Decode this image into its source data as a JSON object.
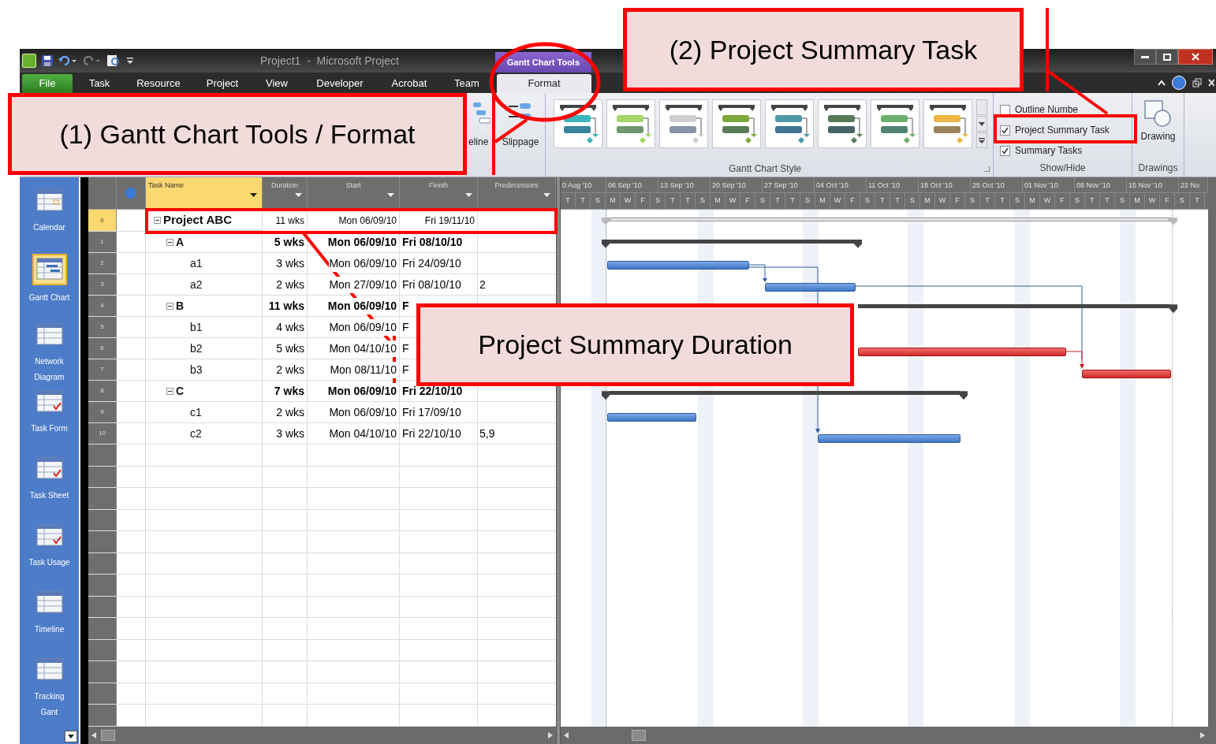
{
  "window": {
    "title": "Project1  -  Microsoft Project"
  },
  "context_tab_group": {
    "label": "Gantt Chart Tools"
  },
  "ribbon_tabs": [
    {
      "label": "File",
      "kind": "backstage",
      "selected": false
    },
    {
      "label": "Task",
      "kind": "tab",
      "selected": false
    },
    {
      "label": "Resource",
      "kind": "tab",
      "selected": false
    },
    {
      "label": "Project",
      "kind": "tab",
      "selected": false
    },
    {
      "label": "View",
      "kind": "tab",
      "selected": false
    },
    {
      "label": "Developer",
      "kind": "tab",
      "selected": false
    },
    {
      "label": "Acrobat",
      "kind": "tab",
      "selected": false
    },
    {
      "label": "Team",
      "kind": "tab",
      "selected": false
    },
    {
      "label": "Format",
      "kind": "contextual",
      "selected": true
    }
  ],
  "ribbon": {
    "partial_button": {
      "label": "eline"
    },
    "slippage": {
      "label": "Slippage"
    },
    "gantt_chart_style": {
      "label": "Gantt Chart Style",
      "styles": [
        {
          "color": "#3cb4bc"
        },
        {
          "color": "#a4d66a"
        },
        {
          "color": "#cfcfcf"
        },
        {
          "color": "#7fa83c"
        },
        {
          "color": "#4f98a6"
        },
        {
          "color": "#567a58"
        },
        {
          "color": "#6cb06c"
        },
        {
          "color": "#f0b442"
        }
      ]
    },
    "show_hide": {
      "label": "Show/Hide",
      "items": [
        {
          "label": "Outline Numbe",
          "checked": false
        },
        {
          "label": "Project Summary Task",
          "checked": true
        },
        {
          "label": "Summary Tasks",
          "checked": true
        }
      ]
    },
    "drawings": {
      "label": "Drawings",
      "button": "Drawing"
    }
  },
  "views": [
    {
      "label": "Calendar",
      "selected": false
    },
    {
      "label": "Gantt Chart",
      "selected": true
    },
    {
      "label": "Network Diagram",
      "selected": false
    },
    {
      "label": "Task Form",
      "selected": false
    },
    {
      "label": "Task Sheet",
      "selected": false
    },
    {
      "label": "Task Usage",
      "selected": false
    },
    {
      "label": "Timeline",
      "selected": false
    },
    {
      "label": "Tracking Gant",
      "selected": false
    }
  ],
  "table": {
    "columns": [
      {
        "label": "Task Name",
        "selected": true
      },
      {
        "label": "Duration",
        "selected": false
      },
      {
        "label": "Start",
        "selected": false
      },
      {
        "label": "Finish",
        "selected": false
      },
      {
        "label": "Predecessors",
        "selected": false
      }
    ],
    "rows": [
      {
        "id": "0",
        "name": "Project ABC",
        "kind": "project",
        "expanded": true,
        "selected": true,
        "duration": "11 wks",
        "start": "Mon 06/09/10",
        "finish": "Fri 19/11/10",
        "children": [
          {
            "id": "1",
            "name": "A",
            "kind": "summary",
            "expanded": true,
            "selected": false,
            "duration": "5 wks",
            "start": "Mon 06/09/10",
            "finish": "Fri 08/10/10",
            "children": [
              {
                "id": "2",
                "name": "a1",
                "kind": "task",
                "critical": false,
                "selected": false,
                "duration": "3 wks",
                "start": "Mon 06/09/10",
                "finish": "Fri 24/09/10"
              },
              {
                "id": "3",
                "name": "a2",
                "kind": "task",
                "critical": false,
                "selected": false,
                "duration": "2 wks",
                "start": "Mon 27/09/10",
                "finish": "Fri 08/10/10",
                "predecessors": "2"
              }
            ]
          },
          {
            "id": "4",
            "name": "B",
            "kind": "summary",
            "expanded": true,
            "selected": false,
            "duration": "11 wks",
            "start": "Mon 06/09/10",
            "finish": "F",
            "children": [
              {
                "id": "5",
                "name": "b1",
                "kind": "task",
                "selected": false,
                "duration": "4 wks",
                "start": "Mon 06/09/10",
                "finish": "F"
              },
              {
                "id": "6",
                "name": "b2",
                "kind": "task",
                "critical": true,
                "selected": false,
                "duration": "5 wks",
                "start": "Mon 04/10/10",
                "finish": "F"
              },
              {
                "id": "7",
                "name": "b3",
                "kind": "task",
                "critical": true,
                "selected": false,
                "duration": "2 wks",
                "start": "Mon 08/11/10",
                "finish": "F"
              }
            ]
          },
          {
            "id": "8",
            "name": "C",
            "kind": "summary",
            "expanded": true,
            "selected": false,
            "duration": "7 wks",
            "start": "Mon 06/09/10",
            "finish": "Fri 22/10/10",
            "children": [
              {
                "id": "9",
                "name": "c1",
                "kind": "task",
                "critical": false,
                "selected": false,
                "duration": "2 wks",
                "start": "Mon 06/09/10",
                "finish": "Fri 17/09/10"
              },
              {
                "id": "10",
                "name": "c2",
                "kind": "task",
                "critical": false,
                "selected": false,
                "duration": "3 wks",
                "start": "Mon 04/10/10",
                "finish": "Fri 22/10/10",
                "predecessors": "5,9"
              }
            ]
          }
        ]
      }
    ]
  },
  "timescale": {
    "weeks": [
      "0 Aug '10",
      "06 Sep '10",
      "13 Sep '10",
      "20 Sep '10",
      "27 Sep '10",
      "04 Oct '10",
      "11 Oct '10",
      "18 Oct '10",
      "25 Oct '10",
      "01 Nov '10",
      "08 Nov '10",
      "15 Nov '10",
      "22 No"
    ],
    "ticks": [
      "T",
      "T",
      "S",
      "M",
      "W",
      "F",
      "S",
      "T",
      "T",
      "S",
      "M",
      "W",
      "F",
      "S",
      "T",
      "T",
      "S",
      "M",
      "W",
      "F",
      "S",
      "T",
      "T",
      "S",
      "M",
      "W",
      "F",
      "S",
      "T",
      "T",
      "S",
      "M",
      "W",
      "F",
      "S",
      "T",
      "T",
      "S",
      "M",
      "W",
      "F",
      "S",
      "T"
    ]
  },
  "callouts": [
    {
      "text": "(1) Gantt Chart Tools / Format"
    },
    {
      "text": "(2) Project Summary Task"
    },
    {
      "text": "Project Summary Duration"
    }
  ]
}
